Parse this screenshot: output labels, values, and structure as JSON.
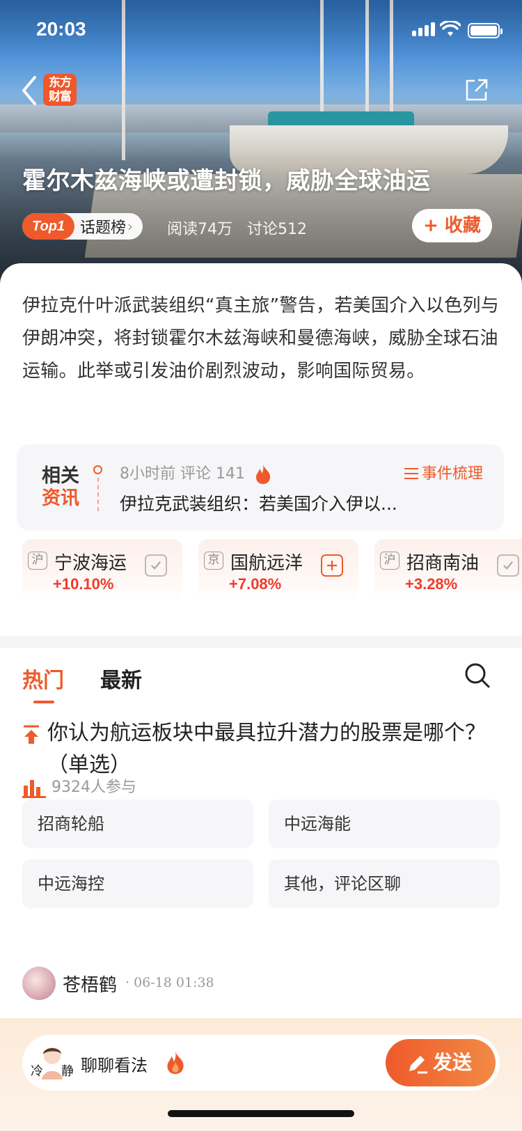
{
  "status_bar": {
    "time": "20:03"
  },
  "header": {
    "logo_line1": "东方",
    "logo_line2": "财富",
    "title": "霍尔木兹海峡或遭封锁，威胁全球油运",
    "rank_badge": "Top1",
    "rank_label": "话题榜",
    "reads": "阅读74万",
    "discussions": "讨论512",
    "favorite_label": "+ 收藏"
  },
  "intro": {
    "text": "伊拉克什叶派武装组织“真主旅”警告，若美国介入以色列与伊朗冲突，将封锁霍尔木兹海峡和曼德海峡，威胁全球石油运输。此举或引发油价剧烈波动，影响国际贸易。"
  },
  "related_news": {
    "tag_line1": "相关",
    "tag_line2": "资讯",
    "meta": "8小时前  评论 141",
    "events_label": "事件梳理",
    "headline": "伊拉克武装组织：若美国介入伊以..."
  },
  "stocks": [
    {
      "market": "沪",
      "name": "宁波海运",
      "change": "+10.10%",
      "action": "check"
    },
    {
      "market": "京",
      "name": "国航远洋",
      "change": "+7.08%",
      "action": "add"
    },
    {
      "market": "沪",
      "name": "招商南油",
      "change": "+3.28%",
      "action": "check"
    }
  ],
  "tabs": [
    {
      "label": "热门",
      "active": true
    },
    {
      "label": "最新",
      "active": false
    }
  ],
  "poll": {
    "question": "你认为航运板块中最具拉升潜力的股票是哪个？ （单选）",
    "participants": "9324人参与",
    "options": [
      "招商轮船",
      "中远海能",
      "中远海控",
      "其他，评论区聊"
    ]
  },
  "comment": {
    "user": "苍梧鹤",
    "time": "· 06-18 01:38"
  },
  "bottom_bar": {
    "avatar_left": "冷",
    "avatar_right": "静",
    "prompt": "聊聊看法",
    "send_label": "发送"
  },
  "colors": {
    "accent": "#ee5a2c",
    "up": "#ee3b2c"
  }
}
